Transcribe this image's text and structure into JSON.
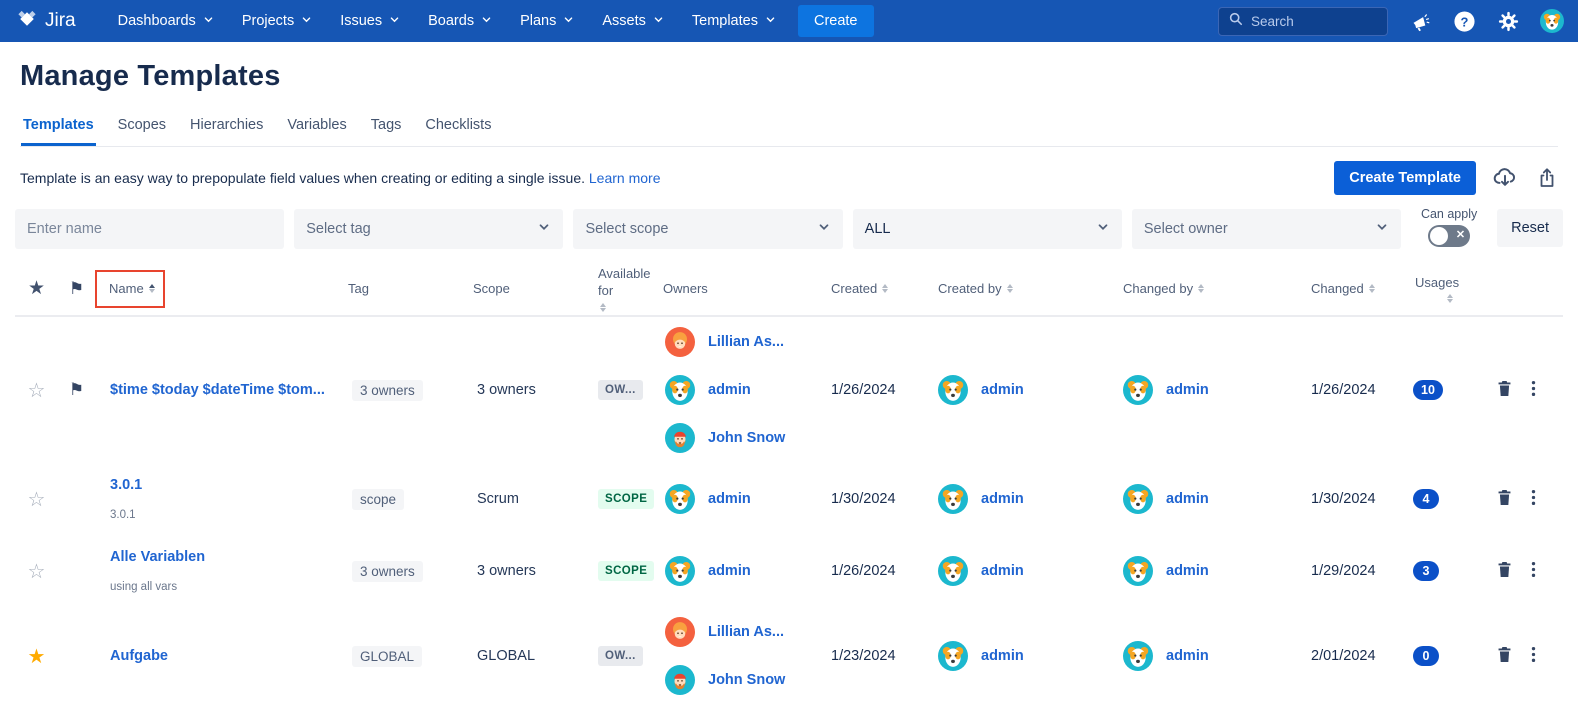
{
  "nav": {
    "brand": "Jira",
    "items": [
      {
        "label": "Dashboards"
      },
      {
        "label": "Projects"
      },
      {
        "label": "Issues"
      },
      {
        "label": "Boards"
      },
      {
        "label": "Plans"
      },
      {
        "label": "Assets"
      },
      {
        "label": "Templates"
      }
    ],
    "create_label": "Create",
    "search_placeholder": "Search"
  },
  "page": {
    "title": "Manage Templates",
    "tabs": [
      {
        "label": "Templates",
        "active": true
      },
      {
        "label": "Scopes",
        "active": false
      },
      {
        "label": "Hierarchies",
        "active": false
      },
      {
        "label": "Variables",
        "active": false
      },
      {
        "label": "Tags",
        "active": false
      },
      {
        "label": "Checklists",
        "active": false
      }
    ],
    "description": "Template is an easy way to prepopulate field values when creating or editing a single issue.",
    "learn_more_label": "Learn more",
    "create_template_label": "Create Template"
  },
  "filters": {
    "name_placeholder": "Enter name",
    "tag_placeholder": "Select tag",
    "scope_placeholder": "Select scope",
    "type_value": "ALL",
    "owner_placeholder": "Select owner",
    "can_apply_label": "Can apply",
    "reset_label": "Reset"
  },
  "colors": {
    "navbar_blue": "#1656B4",
    "nav_create_blue": "#0D74E0",
    "primary_button_blue": "#0B5FD7",
    "link_blue": "#2065D1",
    "active_tab_blue": "#0B63CE",
    "usages_badge_blue": "#0B50C8",
    "scope_chip_bg": "#E3FCEF",
    "scope_chip_text": "#006644",
    "gray_chip_bg": "#F4F5F7",
    "starred_yellow": "#FFAB00",
    "flag_navy": "#344563",
    "annotation_red": "#E8442E",
    "avatar_teal": "#1CB8CE",
    "avatar_orange": "#F4613F"
  },
  "table": {
    "columns": [
      {
        "id": "star",
        "icon": "star-icon"
      },
      {
        "id": "flag",
        "icon": "flag-icon"
      },
      {
        "id": "name",
        "label": "Name",
        "sort": "asc",
        "annotated": true
      },
      {
        "id": "tag",
        "label": "Tag"
      },
      {
        "id": "scope",
        "label": "Scope"
      },
      {
        "id": "available",
        "label": "Available for",
        "sort": "none"
      },
      {
        "id": "owners",
        "label": "Owners"
      },
      {
        "id": "created",
        "label": "Created",
        "sort": "none"
      },
      {
        "id": "created_by",
        "label": "Created by",
        "sort": "none"
      },
      {
        "id": "changed_by",
        "label": "Changed by",
        "sort": "none"
      },
      {
        "id": "changed",
        "label": "Changed",
        "sort": "none"
      },
      {
        "id": "usages",
        "label": "Usages",
        "sort": "none",
        "sort_detached": true
      },
      {
        "id": "actions",
        "label": ""
      }
    ],
    "rows": [
      {
        "starred": false,
        "flagged": true,
        "name": "$time $today $dateTime $tom...",
        "subtitle": "",
        "tag": "3 owners",
        "scope": "3 owners",
        "available": {
          "label": "OW...",
          "style": "gray"
        },
        "owners": [
          {
            "name": "Lillian As...",
            "avatar": "lillian-avatar"
          },
          {
            "name": "admin",
            "avatar": "dog-avatar"
          },
          {
            "name": "John Snow",
            "avatar": "john-avatar"
          }
        ],
        "created": "1/26/2024",
        "created_by": {
          "name": "admin",
          "avatar": "dog-avatar"
        },
        "changed_by": {
          "name": "admin",
          "avatar": "dog-avatar"
        },
        "changed": "1/26/2024",
        "usages": "10"
      },
      {
        "starred": false,
        "flagged": false,
        "name": "3.0.1",
        "subtitle": "3.0.1",
        "tag": "scope",
        "scope": "Scrum",
        "available": {
          "label": "SCOPE",
          "style": "green"
        },
        "owners": [
          {
            "name": "admin",
            "avatar": "dog-avatar"
          }
        ],
        "created": "1/30/2024",
        "created_by": {
          "name": "admin",
          "avatar": "dog-avatar"
        },
        "changed_by": {
          "name": "admin",
          "avatar": "dog-avatar"
        },
        "changed": "1/30/2024",
        "usages": "4"
      },
      {
        "starred": false,
        "flagged": false,
        "name": "Alle Variablen",
        "subtitle": "using all vars",
        "tag": "3 owners",
        "scope": "3 owners",
        "available": {
          "label": "SCOPE",
          "style": "green"
        },
        "owners": [
          {
            "name": "admin",
            "avatar": "dog-avatar"
          }
        ],
        "created": "1/26/2024",
        "created_by": {
          "name": "admin",
          "avatar": "dog-avatar"
        },
        "changed_by": {
          "name": "admin",
          "avatar": "dog-avatar"
        },
        "changed": "1/29/2024",
        "usages": "3"
      },
      {
        "starred": true,
        "flagged": false,
        "name": "Aufgabe",
        "subtitle": "",
        "tag": "GLOBAL",
        "scope": "GLOBAL",
        "available": {
          "label": "OW...",
          "style": "gray"
        },
        "owners": [
          {
            "name": "Lillian As...",
            "avatar": "lillian-avatar"
          },
          {
            "name": "John Snow",
            "avatar": "john-avatar"
          }
        ],
        "created": "1/23/2024",
        "created_by": {
          "name": "admin",
          "avatar": "dog-avatar"
        },
        "changed_by": {
          "name": "admin",
          "avatar": "dog-avatar"
        },
        "changed": "2/01/2024",
        "usages": "0"
      }
    ]
  }
}
